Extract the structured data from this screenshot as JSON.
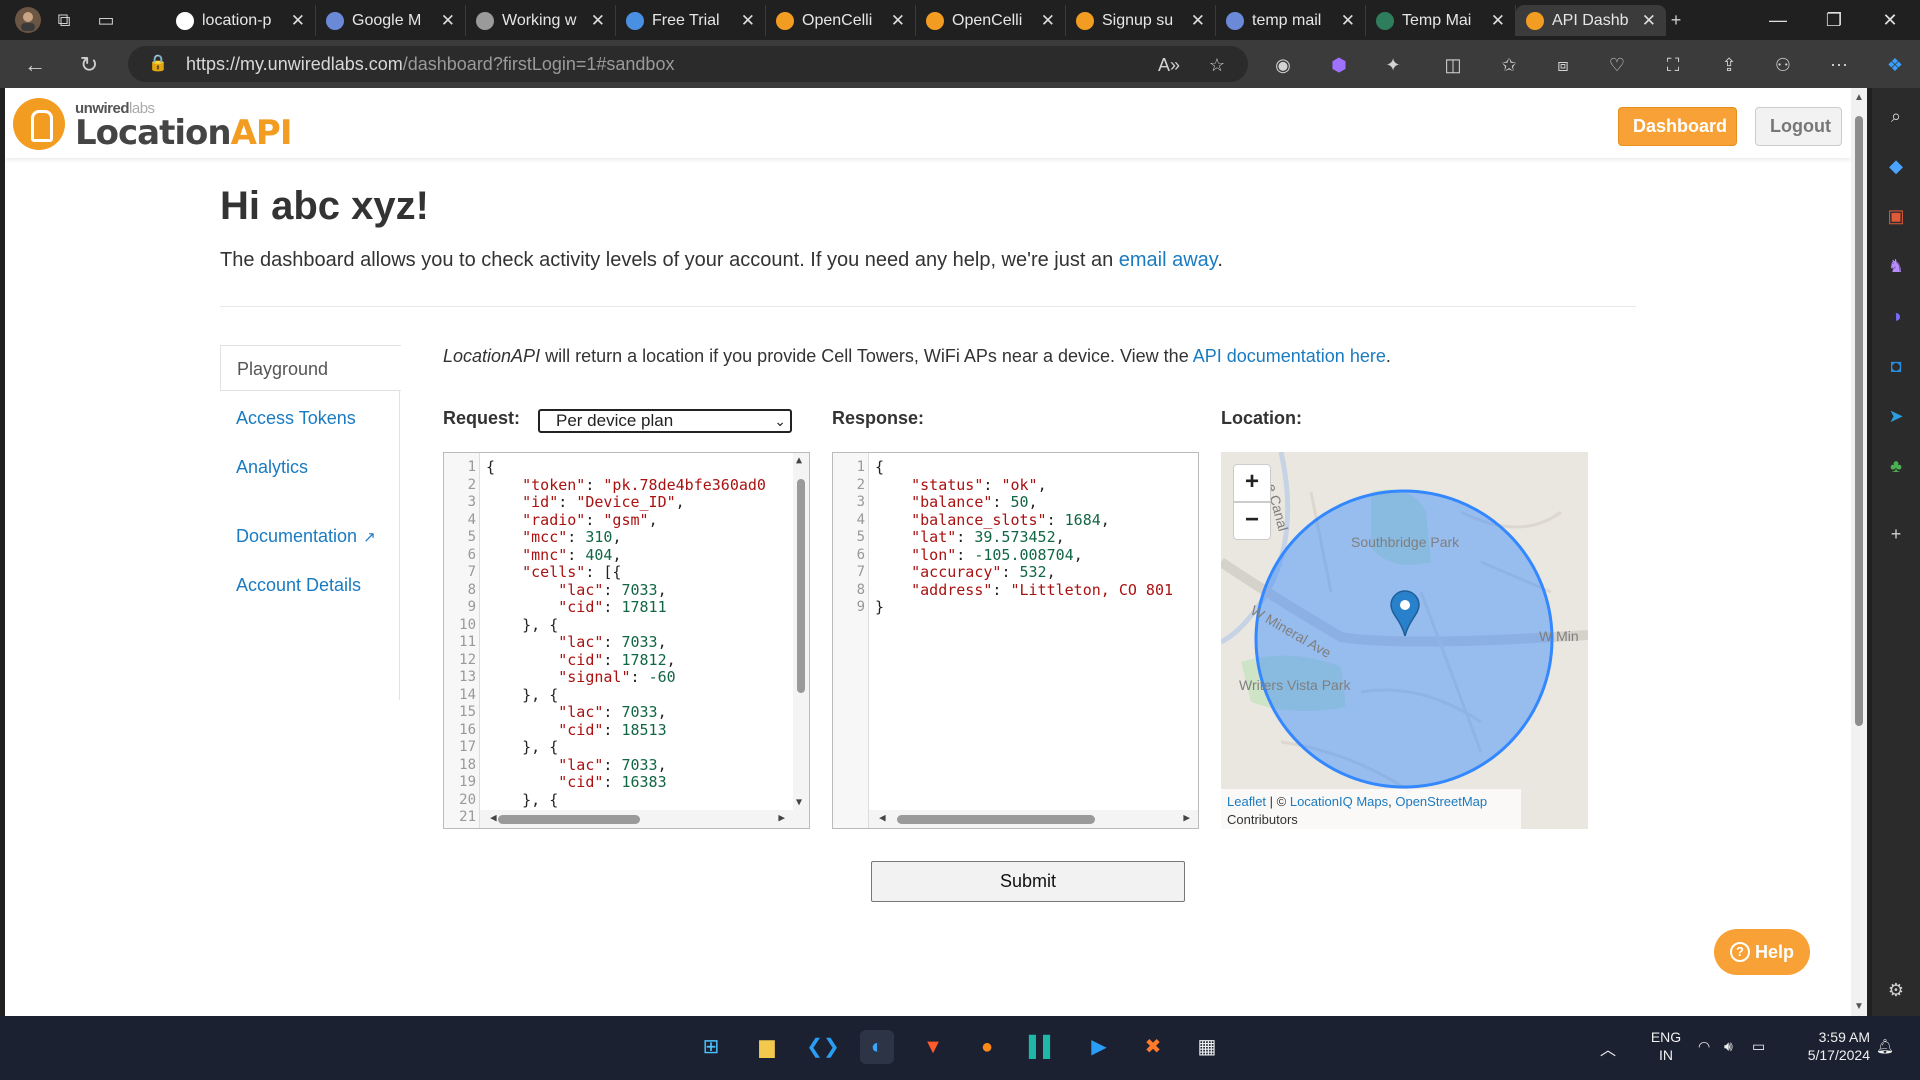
{
  "browser": {
    "tabs": [
      {
        "label": "location-p",
        "favicon": "github-icon",
        "color": "#ffffff"
      },
      {
        "label": "Google M",
        "favicon": "search-icon",
        "color": "#6a8ad8"
      },
      {
        "label": "Working w",
        "favicon": "lightning-icon",
        "color": "#9a9a9a"
      },
      {
        "label": "Free Trial",
        "favicon": "cloud-icon",
        "color": "#4a90e2"
      },
      {
        "label": "OpenCelli",
        "favicon": "opencellid-icon",
        "color": "#f39c22"
      },
      {
        "label": "OpenCelli",
        "favicon": "opencellid-icon",
        "color": "#f39c22"
      },
      {
        "label": "Signup su",
        "favicon": "opencellid-icon",
        "color": "#f39c22"
      },
      {
        "label": "temp mail",
        "favicon": "search-icon",
        "color": "#6a8ad8"
      },
      {
        "label": "Temp Mai",
        "favicon": "tempmail-icon",
        "color": "#2e7d5b"
      },
      {
        "label": "API Dashb",
        "favicon": "unwiredlabs-icon",
        "color": "#f39c22"
      }
    ],
    "url_host": "https://my.unwiredlabs.com",
    "url_path": "/dashboard?firstLogin=1#sandbox"
  },
  "header": {
    "logo_small_a": "unwired",
    "logo_small_b": "labs",
    "logo_big_a": "Location",
    "logo_big_b": "API",
    "dashboard_label": "Dashboard",
    "logout_label": "Logout"
  },
  "page": {
    "greeting": "Hi abc xyz!",
    "intro_text": "The dashboard allows you to check activity levels of your account. If you need any help, we're just an ",
    "intro_link": "email away",
    "intro_end": ".",
    "desc_em": "LocationAPI",
    "desc_text": " will return a location if you provide Cell Towers, WiFi APs near a device. View the ",
    "desc_link": "API documentation here",
    "desc_end": "."
  },
  "nav": {
    "playground": "Playground",
    "access_tokens": "Access Tokens",
    "analytics": "Analytics",
    "documentation": "Documentation",
    "account_details": "Account Details"
  },
  "labels": {
    "request": "Request:",
    "response": "Response:",
    "location": "Location:",
    "select_value": "Per device plan"
  },
  "request_lines": [
    "{",
    "    \"token\": \"pk.78de4bfe360ad0",
    "    \"id\": \"Device_ID\",",
    "    \"radio\": \"gsm\",",
    "    \"mcc\": 310,",
    "    \"mnc\": 404,",
    "    \"cells\": [{",
    "        \"lac\": 7033,",
    "        \"cid\": 17811",
    "    }, {",
    "        \"lac\": 7033,",
    "        \"cid\": 17812,",
    "        \"signal\": -60",
    "    }, {",
    "        \"lac\": 7033,",
    "        \"cid\": 18513",
    "    }, {",
    "        \"lac\": 7033,",
    "        \"cid\": 16383",
    "    }, {",
    ""
  ],
  "response_lines": [
    "{",
    "    \"status\": \"ok\",",
    "    \"balance\": 50,",
    "    \"balance_slots\": 1684,",
    "    \"lat\": 39.573452,",
    "    \"lon\": -105.008704,",
    "    \"accuracy\": 532,",
    "    \"address\": \"Littleton, CO 801",
    "}"
  ],
  "map": {
    "zoom_in": "+",
    "zoom_out": "−",
    "label_park1": "Southbridge Park",
    "label_park2": "Writers Vista Park",
    "label_street": "W Mineral Ave",
    "label_street2": "W Min",
    "label_canal": "e Canal",
    "attrib_leaflet": "Leaflet",
    "attrib_sep": " | © ",
    "attrib_liq": "LocationIQ Maps",
    "attrib_comma": ", ",
    "attrib_osm": "OpenStreetMap",
    "attrib_contrib": "Contributors",
    "circle_color": "#3388ff"
  },
  "buttons": {
    "submit": "Submit",
    "help": "Help"
  },
  "taskbar": {
    "lang_a": "ENG",
    "lang_b": "IN",
    "time": "3:59 AM",
    "date": "5/17/2024"
  }
}
